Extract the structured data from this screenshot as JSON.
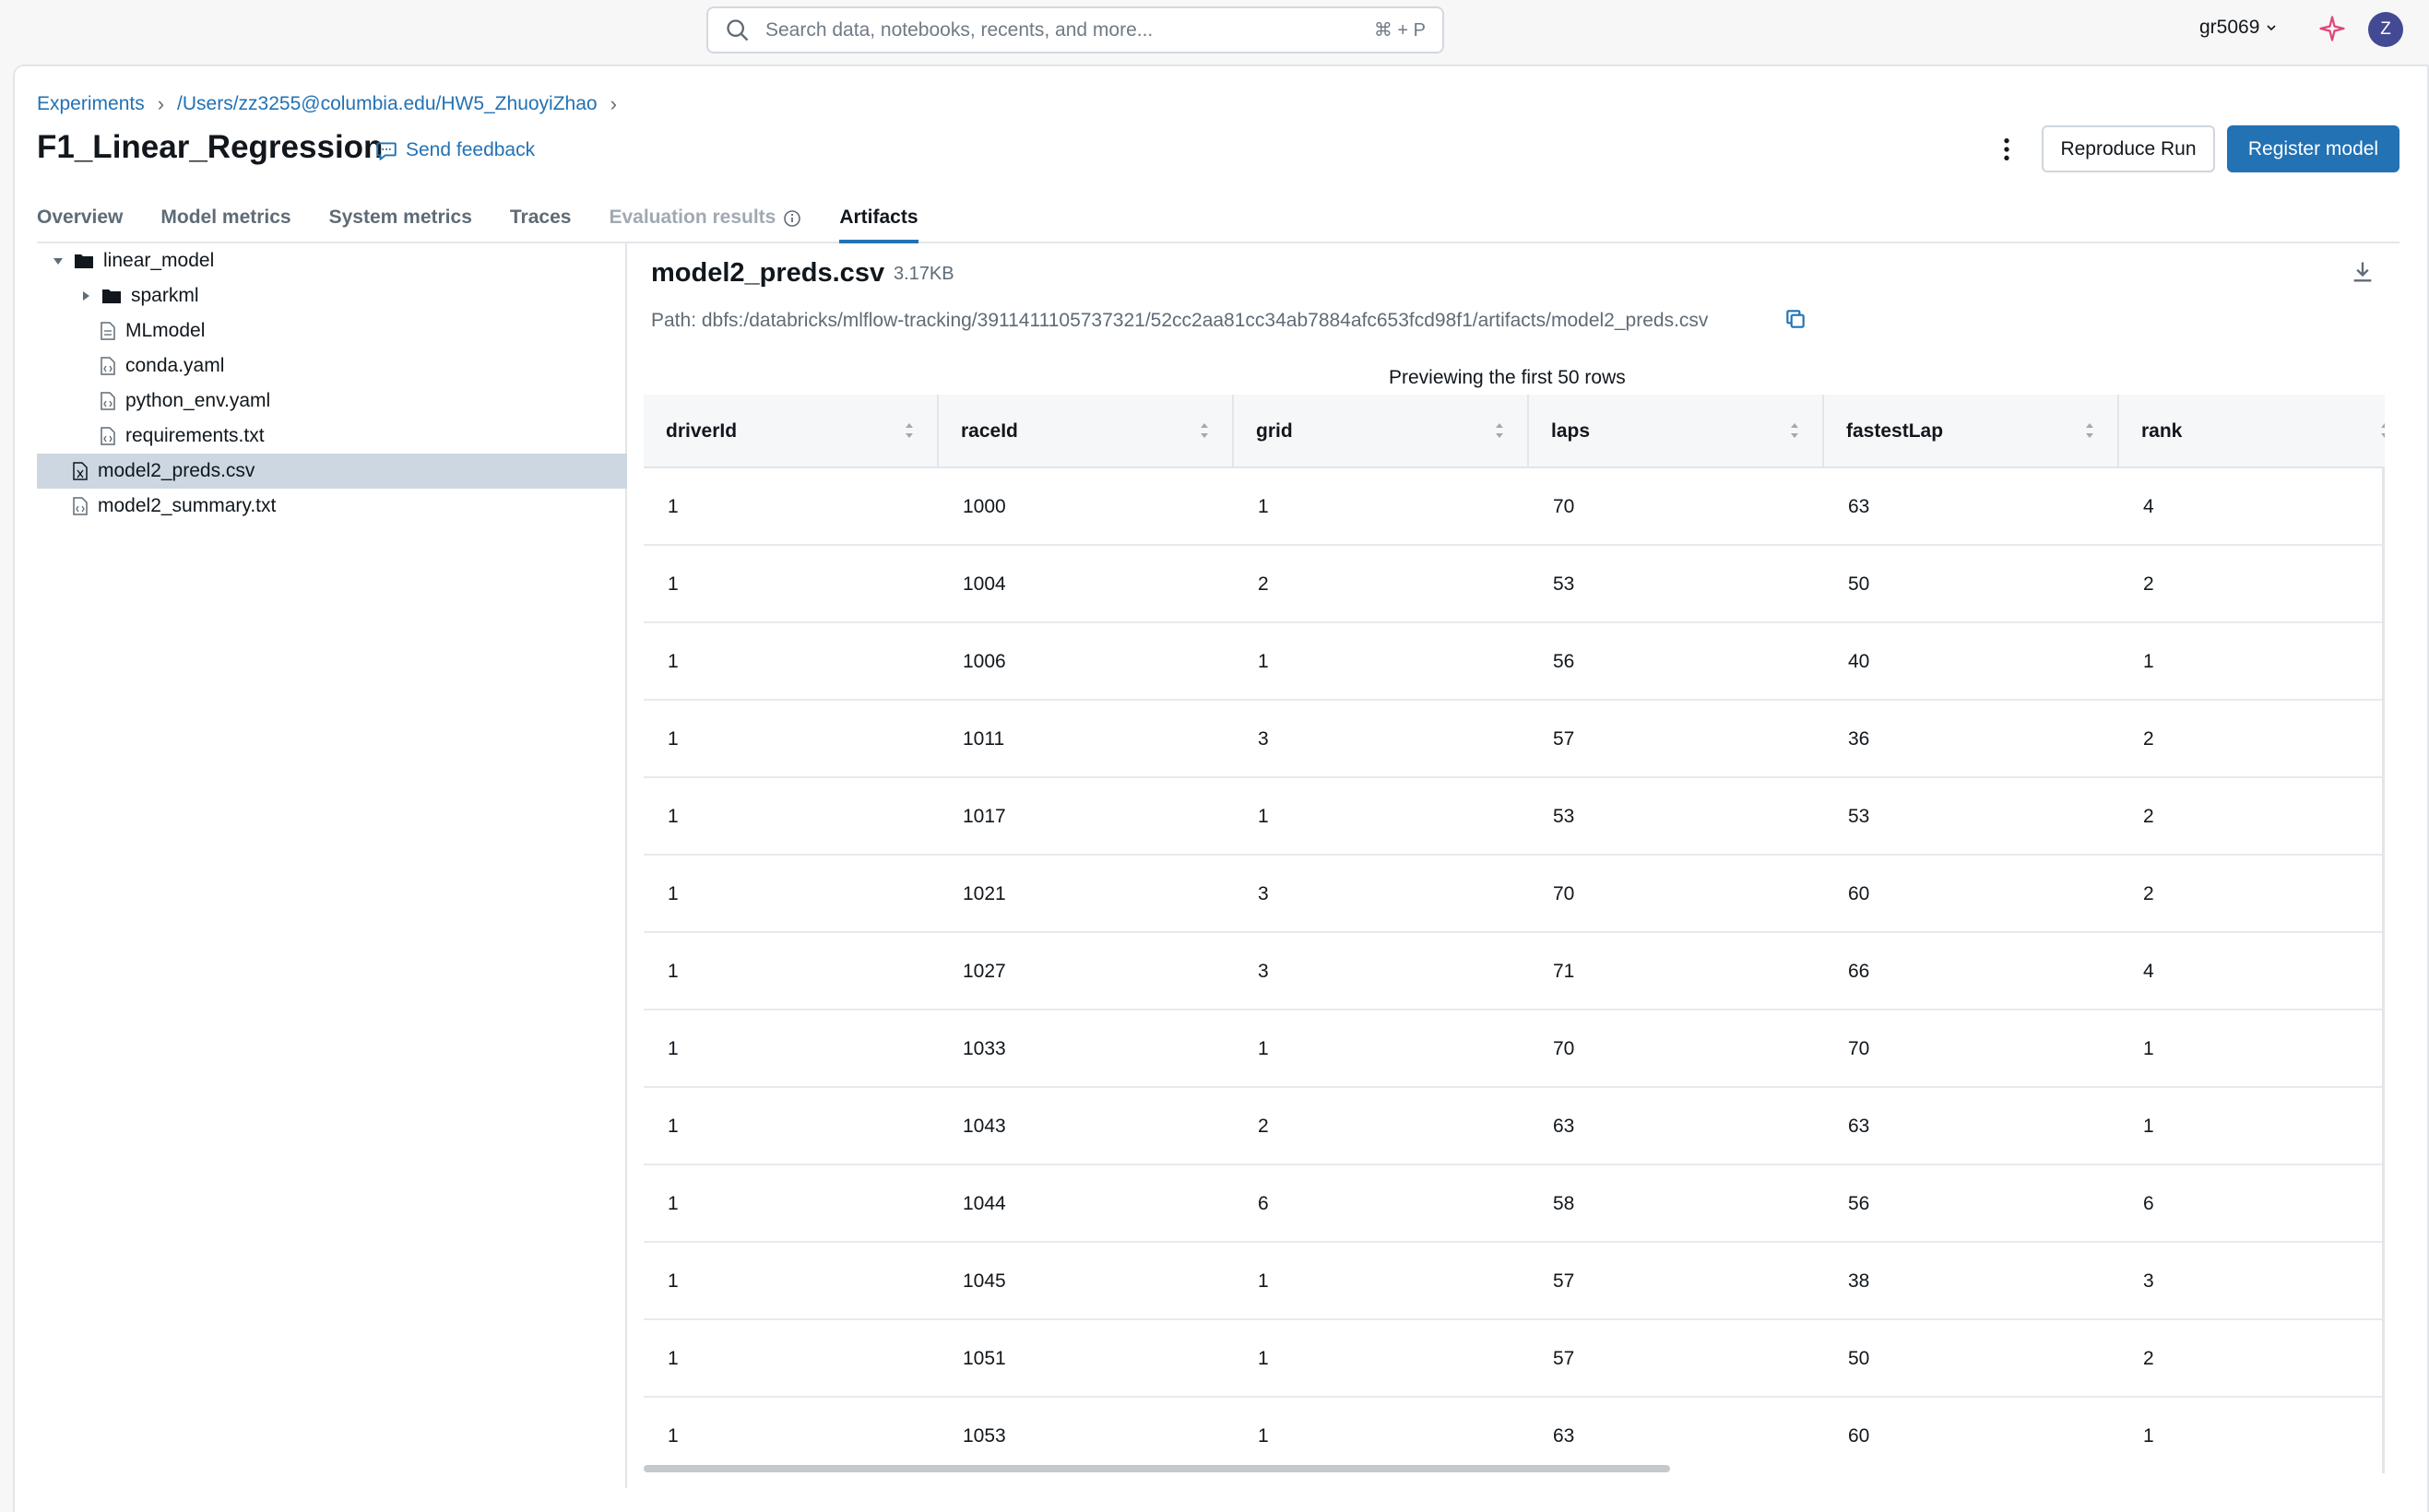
{
  "search": {
    "placeholder": "Search data, notebooks, recents, and more...",
    "shortcut": "⌘ + P"
  },
  "workspace": {
    "name": "gr5069"
  },
  "user": {
    "initial": "Z"
  },
  "breadcrumb": {
    "items": [
      "Experiments",
      "/Users/zz3255@columbia.edu/HW5_ZhuoyiZhao"
    ]
  },
  "run": {
    "title": "F1_Linear_Regression",
    "feedback_label": "Send feedback"
  },
  "actions": {
    "reproduce_label": "Reproduce Run",
    "register_label": "Register model"
  },
  "tabs": [
    {
      "label": "Overview",
      "state": "normal"
    },
    {
      "label": "Model metrics",
      "state": "normal"
    },
    {
      "label": "System metrics",
      "state": "normal"
    },
    {
      "label": "Traces",
      "state": "normal"
    },
    {
      "label": "Evaluation results",
      "state": "disabled"
    },
    {
      "label": "Artifacts",
      "state": "active"
    }
  ],
  "tree": [
    {
      "label": "linear_model",
      "type": "folder",
      "expanded": true
    },
    {
      "label": "sparkml",
      "type": "folder",
      "expanded": false
    },
    {
      "label": "MLmodel",
      "type": "file"
    },
    {
      "label": "conda.yaml",
      "type": "code-file"
    },
    {
      "label": "python_env.yaml",
      "type": "code-file"
    },
    {
      "label": "requirements.txt",
      "type": "code-file"
    },
    {
      "label": "model2_preds.csv",
      "type": "csv-file",
      "selected": true
    },
    {
      "label": "model2_summary.txt",
      "type": "code-file"
    }
  ],
  "preview": {
    "file_name": "model2_preds.csv",
    "file_size": "3.17KB",
    "path": "Path: dbfs:/databricks/mlflow-tracking/3911411105737321/52cc2aa81cc34ab7884afc653fcd98f1/artifacts/model2_preds.csv",
    "note": "Previewing the first 50 rows"
  },
  "table": {
    "columns": [
      "driverId",
      "raceId",
      "grid",
      "laps",
      "fastestLap",
      "rank"
    ],
    "rows": [
      [
        "1",
        "1000",
        "1",
        "70",
        "63",
        "4"
      ],
      [
        "1",
        "1004",
        "2",
        "53",
        "50",
        "2"
      ],
      [
        "1",
        "1006",
        "1",
        "56",
        "40",
        "1"
      ],
      [
        "1",
        "1011",
        "3",
        "57",
        "36",
        "2"
      ],
      [
        "1",
        "1017",
        "1",
        "53",
        "53",
        "2"
      ],
      [
        "1",
        "1021",
        "3",
        "70",
        "60",
        "2"
      ],
      [
        "1",
        "1027",
        "3",
        "71",
        "66",
        "4"
      ],
      [
        "1",
        "1033",
        "1",
        "70",
        "70",
        "1"
      ],
      [
        "1",
        "1043",
        "2",
        "63",
        "63",
        "1"
      ],
      [
        "1",
        "1044",
        "6",
        "58",
        "56",
        "6"
      ],
      [
        "1",
        "1045",
        "1",
        "57",
        "38",
        "3"
      ],
      [
        "1",
        "1051",
        "1",
        "57",
        "50",
        "2"
      ],
      [
        "1",
        "1053",
        "1",
        "63",
        "60",
        "1"
      ]
    ]
  },
  "colors": {
    "accent": "#2272b4",
    "selected_row": "#cdd7e1",
    "sparkle": "#e0457b",
    "avatar": "#434a93"
  }
}
